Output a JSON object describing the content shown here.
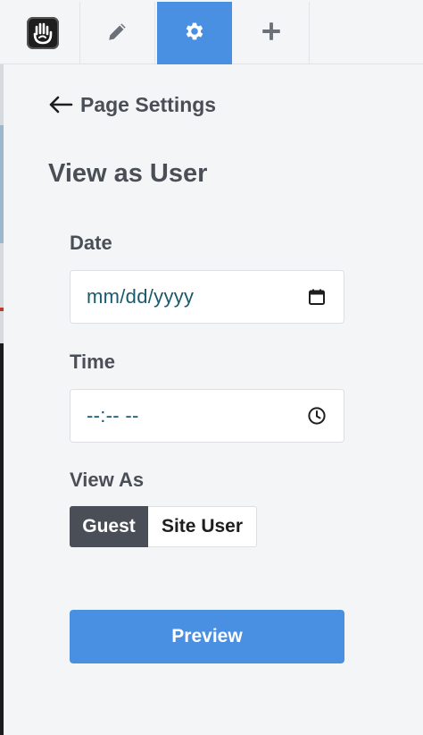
{
  "toolbar": {
    "logo_icon": "concrete5-hand-icon",
    "edit_icon": "pencil-icon",
    "settings_icon": "gear-icon",
    "add_icon": "plus-icon",
    "active_color": "#4a90e2"
  },
  "panel": {
    "back_label": "Page Settings",
    "title": "View as User",
    "date": {
      "label": "Date",
      "placeholder": "mm/dd/yyyy",
      "icon": "calendar-icon"
    },
    "time": {
      "label": "Time",
      "placeholder": "--:-- --",
      "icon": "clock-icon"
    },
    "view_as": {
      "label": "View As",
      "options": [
        "Guest",
        "Site User"
      ],
      "selected": "Guest"
    },
    "preview_label": "Preview"
  }
}
